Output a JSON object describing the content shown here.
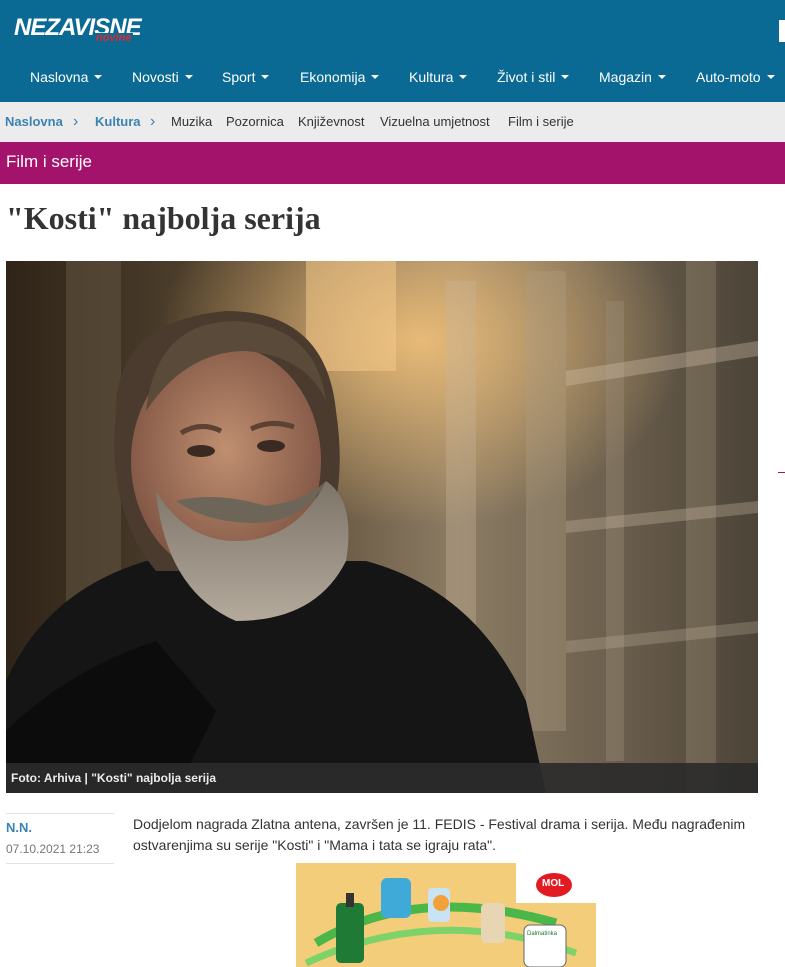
{
  "brand": {
    "name": "NEZAVISNE",
    "sub": "novine"
  },
  "nav": {
    "items": [
      {
        "label": "Naslovna"
      },
      {
        "label": "Novosti"
      },
      {
        "label": "Sport"
      },
      {
        "label": "Ekonomija"
      },
      {
        "label": "Kultura"
      },
      {
        "label": "Život i stil"
      },
      {
        "label": "Magazin"
      },
      {
        "label": "Auto-moto"
      }
    ]
  },
  "breadcrumb": {
    "home": "Naslovna",
    "section": "Kultura",
    "subsections": [
      "Muzika",
      "Pozornica",
      "Književnost",
      "Vizuelna umjetnost",
      "Film i serije"
    ]
  },
  "section_bar": {
    "label": "Film i serije"
  },
  "article": {
    "title": "\"Kosti\" najbolja serija",
    "image_caption": "Foto: Arhiva | \"Kosti\" najbolja serija",
    "author": "N.N.",
    "date": "07.10.2021 21:23",
    "lead": "Dodjelom nagrada Zlatna antena, završen je 11. FEDIS - Festival drama i serija. Među nagrađenim ostvarenjima su serije \"Kosti\" i \"Mama i tata se igraju rata\"."
  },
  "ad": {
    "brand": "MOL",
    "app_label": "Dalmatinka"
  },
  "colors": {
    "header": "#0b6a94",
    "section": "#a3136b",
    "link": "#3b82b4",
    "crumb_bg": "#ececec"
  }
}
